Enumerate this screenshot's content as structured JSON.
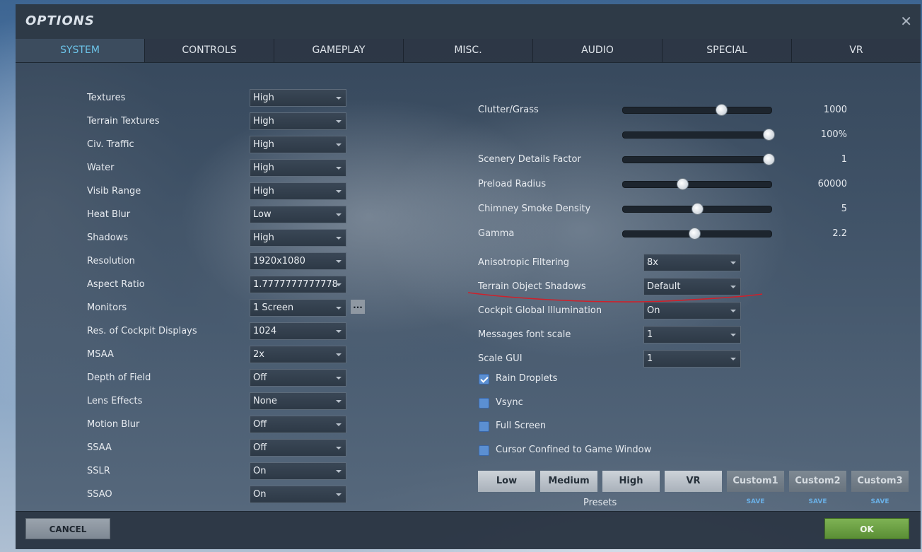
{
  "window": {
    "title": "OPTIONS",
    "close_glyph": "✕"
  },
  "tabs": [
    {
      "label": "SYSTEM",
      "active": true
    },
    {
      "label": "CONTROLS"
    },
    {
      "label": "GAMEPLAY"
    },
    {
      "label": "MISC."
    },
    {
      "label": "AUDIO"
    },
    {
      "label": "SPECIAL"
    },
    {
      "label": "VR"
    }
  ],
  "left_settings": [
    {
      "label": "Textures",
      "value": "High"
    },
    {
      "label": "Terrain Textures",
      "value": "High"
    },
    {
      "label": "Civ. Traffic",
      "value": "High"
    },
    {
      "label": "Water",
      "value": "High"
    },
    {
      "label": "Visib Range",
      "value": "High"
    },
    {
      "label": "Heat Blur",
      "value": "Low"
    },
    {
      "label": "Shadows",
      "value": "High"
    },
    {
      "label": "Resolution",
      "value": "1920x1080"
    },
    {
      "label": "Aspect Ratio",
      "value": "1.7777777777778"
    },
    {
      "label": "Monitors",
      "value": "1 Screen"
    },
    {
      "label": "Res. of Cockpit Displays",
      "value": "1024"
    },
    {
      "label": "MSAA",
      "value": "2x"
    },
    {
      "label": "Depth of Field",
      "value": "Off"
    },
    {
      "label": "Lens Effects",
      "value": "None"
    },
    {
      "label": "Motion Blur",
      "value": "Off"
    },
    {
      "label": "SSAA",
      "value": "Off"
    },
    {
      "label": "SSLR",
      "value": "On"
    },
    {
      "label": "SSAO",
      "value": "On"
    }
  ],
  "monitors_more_label": "...",
  "sliders": [
    {
      "label": "Clutter/Grass",
      "value": "1000",
      "fraction": 0.66
    },
    {
      "label": "",
      "value": "100%",
      "fraction": 0.98
    },
    {
      "label": "Scenery Details Factor",
      "value": "1",
      "fraction": 0.98
    },
    {
      "label": "Preload Radius",
      "value": "60000",
      "fraction": 0.4
    },
    {
      "label": "Chimney Smoke Density",
      "value": "5",
      "fraction": 0.5
    },
    {
      "label": "Gamma",
      "value": "2.2",
      "fraction": 0.48
    }
  ],
  "right_settings": [
    {
      "label": "Anisotropic Filtering",
      "value": "8x"
    },
    {
      "label": "Terrain Object Shadows",
      "value": "Default"
    },
    {
      "label": "Cockpit Global Illumination",
      "value": "On"
    },
    {
      "label": "Messages font scale",
      "value": "1"
    },
    {
      "label": "Scale GUI",
      "value": "1"
    }
  ],
  "checkboxes": [
    {
      "label": "Rain Droplets",
      "checked": true
    },
    {
      "label": "Vsync",
      "checked": false
    },
    {
      "label": "Full Screen",
      "checked": false
    },
    {
      "label": "Cursor Confined to Game Window",
      "checked": false
    }
  ],
  "presets": {
    "label": "Presets",
    "buttons": [
      "Low",
      "Medium",
      "High",
      "VR",
      "Custom1",
      "Custom2",
      "Custom3"
    ],
    "save_label": "SAVE"
  },
  "footer": {
    "cancel_label": "CANCEL",
    "ok_label": "OK"
  },
  "colors": {
    "active_tab": "#6cc3e8",
    "ok_green": "#6fa346",
    "annotation_red": "#d0202a",
    "checkbox_blue": "#5b8fd2"
  }
}
